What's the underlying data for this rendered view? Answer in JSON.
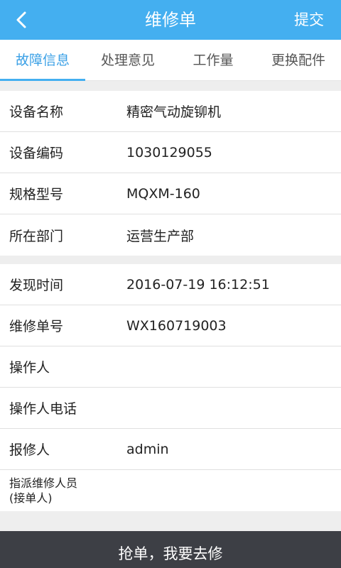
{
  "header": {
    "back_icon": "chevron-left-icon",
    "title": "维修单",
    "submit_label": "提交"
  },
  "tabs": [
    {
      "label": "故障信息",
      "active": true
    },
    {
      "label": "处理意见",
      "active": false
    },
    {
      "label": "工作量",
      "active": false
    },
    {
      "label": "更换配件",
      "active": false
    }
  ],
  "equipment": {
    "name_label": "设备名称",
    "name_value": "精密气动旋铆机",
    "code_label": "设备编码",
    "code_value": "1030129055",
    "model_label": "规格型号",
    "model_value": "MQXM-160",
    "dept_label": "所在部门",
    "dept_value": "运营生产部"
  },
  "repair": {
    "found_time_label": "发现时间",
    "found_time_value": "2016-07-19 16:12:51",
    "order_no_label": "维修单号",
    "order_no_value": "WX160719003",
    "operator_label": "操作人",
    "operator_value": "",
    "operator_phone_label": "操作人电话",
    "operator_phone_value": "",
    "reporter_label": "报修人",
    "reporter_value": "admin",
    "assignee_label_line1": "指派维修人员",
    "assignee_label_line2": "(接单人)",
    "assignee_value": ""
  },
  "bottom": {
    "grab_label": "抢单，我要去修"
  },
  "colors": {
    "primary": "#44aff0",
    "active_tab_text": "#3aa0e6",
    "bottom_bar": "#3d3f45",
    "background": "#eeeeee"
  }
}
